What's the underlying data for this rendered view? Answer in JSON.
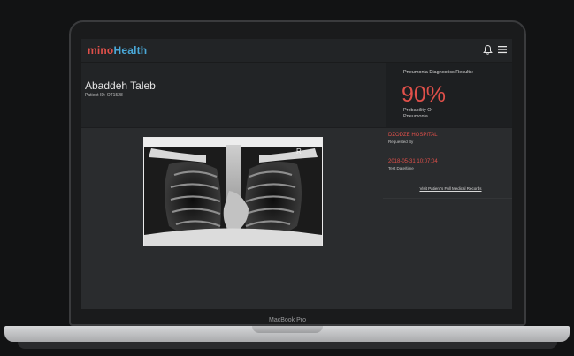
{
  "app": {
    "logo_part1": "mino",
    "logo_part2": "Health"
  },
  "navbar": {
    "bell_icon": "bell-icon",
    "menu_icon": "hamburger-menu-icon"
  },
  "patient": {
    "name": "Abaddeh Taleb",
    "id_label": "Patient ID: OT1528"
  },
  "diagnostics": {
    "title": "Pneumonia Diagnostics Results:",
    "value": "90%",
    "description": "Probability Of Pneumonia",
    "accent_color": "#e0504a"
  },
  "details": {
    "hospital": "DZODZE HOSPITAL",
    "requested_label": "Requested By",
    "datetime": "2018-05-31 10:07:04",
    "datetime_label": "Test Date/time",
    "records_link": "Visit Patient's Full Medical Records"
  },
  "xray": {
    "marker": "R"
  },
  "device": {
    "model": "MacBook Pro"
  }
}
